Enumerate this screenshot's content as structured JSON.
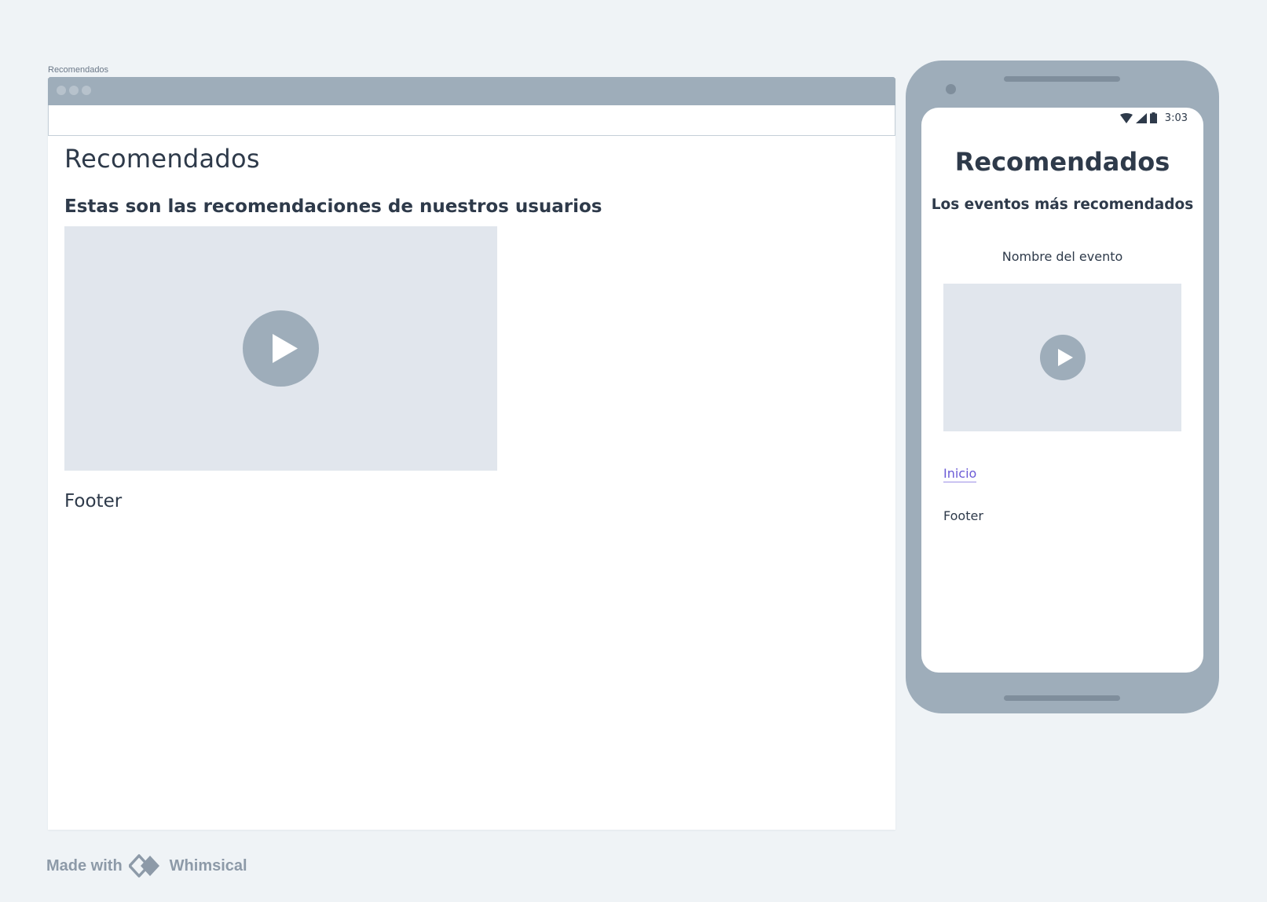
{
  "frame_label": "Recomendados",
  "desktop": {
    "title": "Recomendados",
    "subtitle": "Estas son las recomendaciones de nuestros usuarios",
    "video_play_icon": "play-icon",
    "footer": "Footer"
  },
  "mobile": {
    "status_bar": {
      "time": "3:03",
      "icons": [
        "wifi-icon",
        "signal-icon",
        "battery-icon"
      ]
    },
    "title": "Recomendados",
    "subtitle": "Los eventos más recomendados",
    "event_name": "Nombre del evento",
    "video_play_icon": "play-icon",
    "link": "Inicio",
    "footer": "Footer"
  },
  "watermark": {
    "made_with": "Made with",
    "brand": "Whimsical"
  },
  "colors": {
    "background": "#eff3f6",
    "frame_gray": "#9eadba",
    "placeholder": "#e1e6ed",
    "text": "#2e3a4a",
    "link": "#6b5bd6"
  }
}
